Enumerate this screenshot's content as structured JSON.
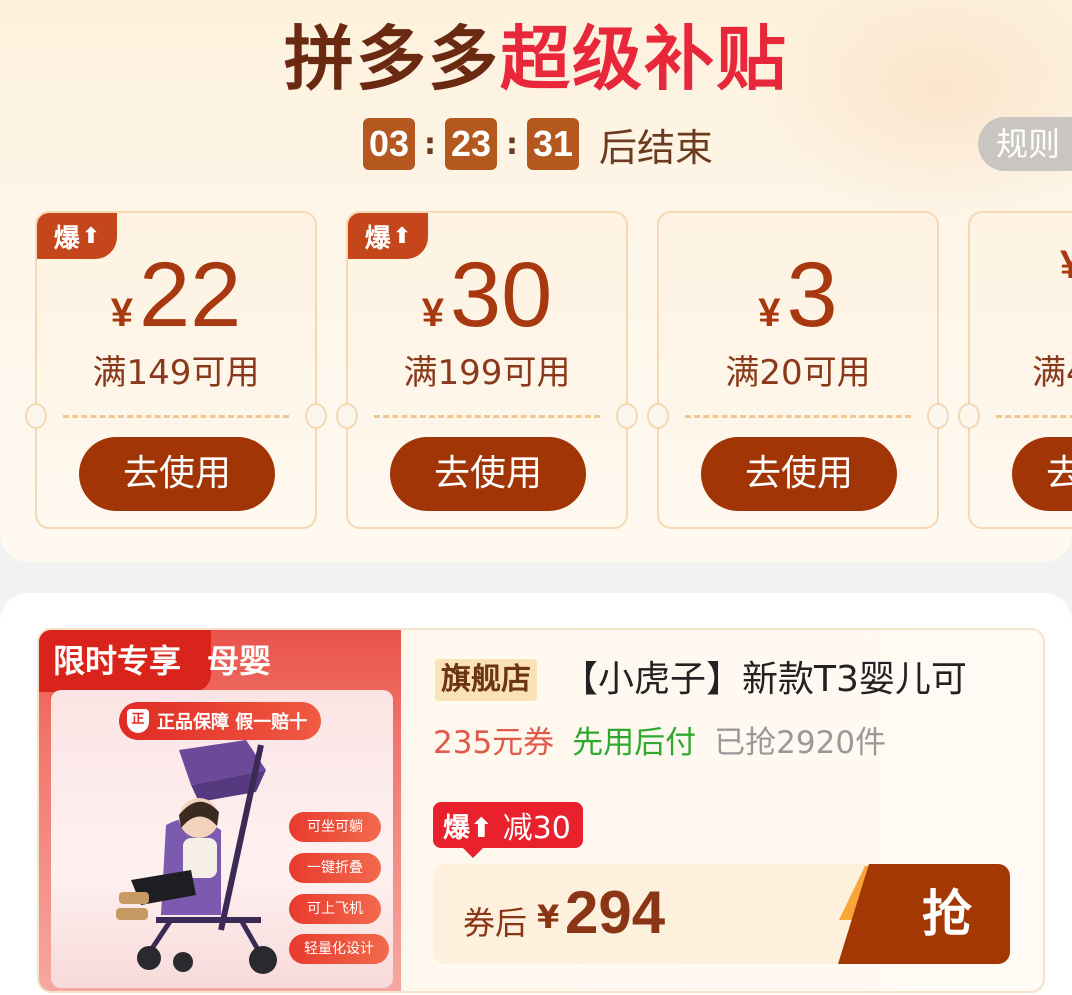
{
  "header": {
    "title_part1": "拼多多",
    "title_part2": "超级补贴",
    "countdown": {
      "hours": "03",
      "minutes": "23",
      "seconds": "31",
      "separator": ":",
      "suffix": "后结束"
    },
    "rules_label": "规则"
  },
  "coupons": [
    {
      "badge": "爆",
      "currency": "¥",
      "amount": "22",
      "condition": "满149可用",
      "button": "去使用"
    },
    {
      "badge": "爆",
      "currency": "¥",
      "amount": "30",
      "condition": "满199可用",
      "button": "去使用"
    },
    {
      "badge": "",
      "currency": "¥",
      "amount": "3",
      "condition": "满20可用",
      "button": "去使用"
    },
    {
      "badge": "",
      "currency": "¥",
      "amount": "",
      "condition": "满4",
      "button": "去"
    }
  ],
  "product": {
    "image_tag": "限时专享",
    "image_tag_tail": "母婴",
    "guarantee": "正品保障 假一赔十",
    "guarantee_icon": "正",
    "features": [
      "可坐可躺",
      "一键折叠",
      "可上飞机",
      "轻量化设计"
    ],
    "shop_badge": "旗舰店",
    "name": "【小虎子】新款T3婴儿可",
    "coupon_text": "235元券",
    "pay_later": "先用后付",
    "sold": "已抢2920件",
    "discount_badge": "爆",
    "discount_text": "减30",
    "price_label": "券后",
    "currency": "¥",
    "price": "294",
    "buy_button": "抢"
  },
  "colors": {
    "brand_brown": "#a23506",
    "accent_red": "#e8283a",
    "timer_box": "#b5581f",
    "paylater_green": "#2faa2f"
  }
}
